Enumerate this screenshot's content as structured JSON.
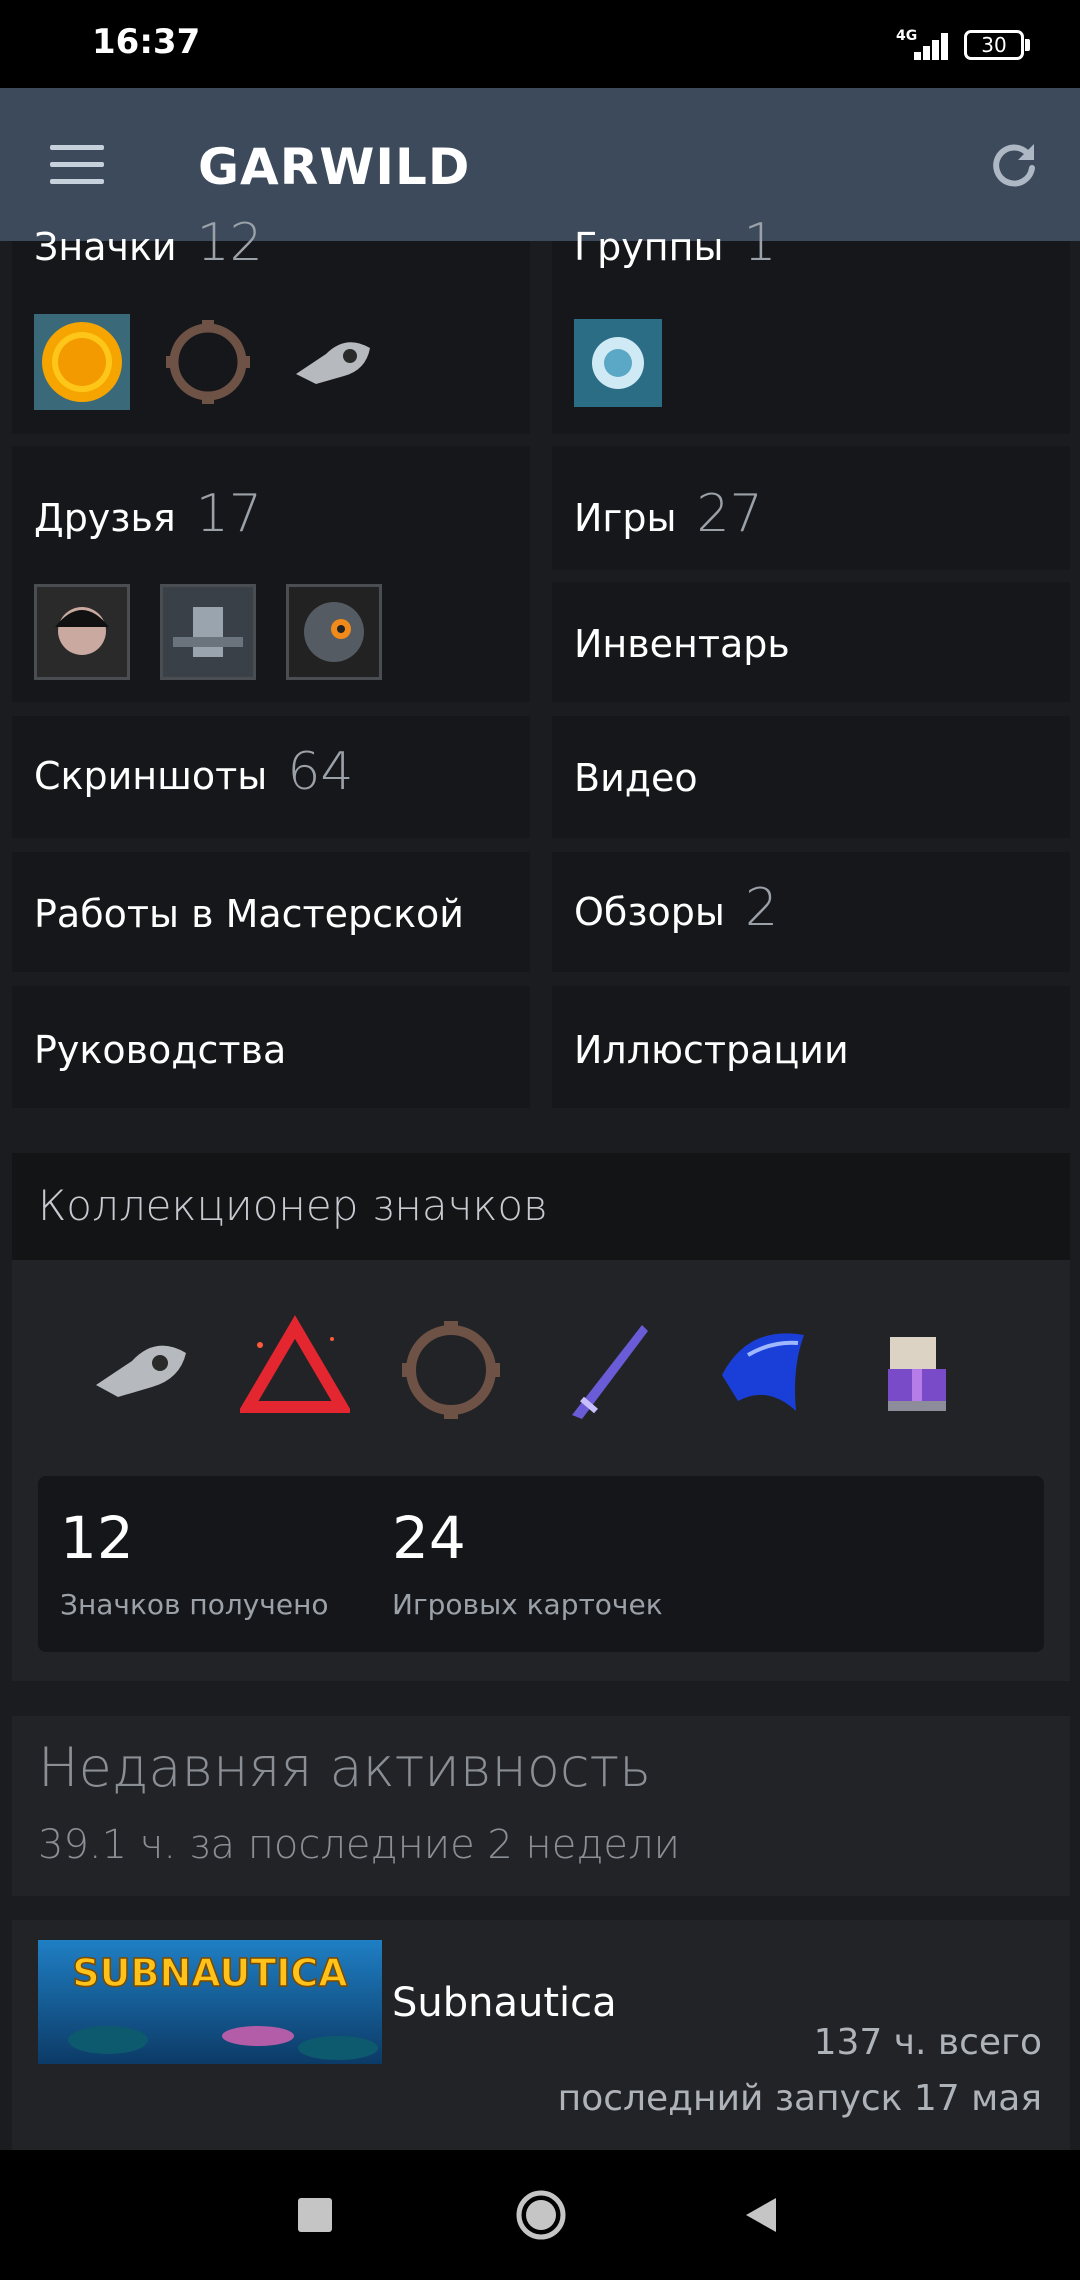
{
  "status": {
    "time": "16:37",
    "network": "4G",
    "battery": "30"
  },
  "header": {
    "title": "GARWILD"
  },
  "badges_card": {
    "label": "Значки",
    "count": "12"
  },
  "groups_card": {
    "label": "Группы",
    "count": "1"
  },
  "friends_card": {
    "label": "Друзья",
    "count": "17"
  },
  "games_card": {
    "label": "Игры",
    "count": "27"
  },
  "inventory_card": {
    "label": "Инвентарь"
  },
  "screenshots_card": {
    "label": "Скриншоты",
    "count": "64"
  },
  "video_card": {
    "label": "Видео"
  },
  "workshop_card": {
    "label": "Работы в Мастерской"
  },
  "reviews_card": {
    "label": "Обзоры",
    "count": "2"
  },
  "guides_card": {
    "label": "Руководства"
  },
  "artwork_card": {
    "label": "Иллюстрации"
  },
  "collector": {
    "title": "Коллекционер значков",
    "badges_count": "12",
    "badges_label": "Значков получено",
    "cards_count": "24",
    "cards_label": "Игровых карточек"
  },
  "recent": {
    "title": "Недавняя активность",
    "subtitle": "39.1 ч. за последние 2 недели"
  },
  "game": {
    "thumb_text": "SUBNAUTICA",
    "name": "Subnautica",
    "hours": "137 ч. всего",
    "last_played": "последний запуск 17 мая"
  },
  "colors": {
    "header": "#3c4a5c",
    "card": "#16171a",
    "panel": "#222326",
    "muted": "#9ba1a8"
  }
}
